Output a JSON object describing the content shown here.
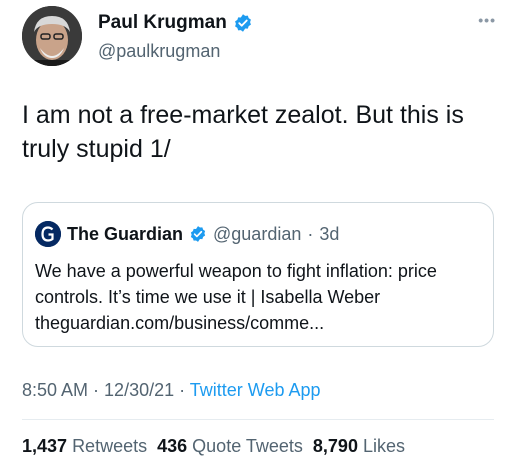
{
  "author": {
    "display_name": "Paul Krugman",
    "handle": "@paulkrugman",
    "verified": true
  },
  "more_icon": "more-options-icon",
  "tweet": {
    "text": "I am not a free-market zealot. But this is truly stupid 1/"
  },
  "quoted_tweet": {
    "author_name": "The Guardian",
    "handle": "@guardian",
    "separator": "·",
    "age": "3d",
    "text": "We have a powerful weapon to fight inflation: price controls. It’s time we use it | Isabella Weber",
    "link": "theguardian.com/business/comme..."
  },
  "meta": {
    "time": "8:50 AM",
    "sep1": " · ",
    "date": "12/30/21",
    "sep2": " · ",
    "app": "Twitter Web App"
  },
  "stats": {
    "retweets_count": "1,437",
    "retweets_label": "Retweets",
    "quotes_count": "436",
    "quotes_label": "Quote Tweets",
    "likes_count": "8,790",
    "likes_label": "Likes"
  },
  "colors": {
    "verified_blue": "#1d9bf0",
    "link_blue": "#1d9bf0",
    "guardian_navy": "#052962",
    "text": "#0f1419",
    "secondary": "#536471"
  }
}
